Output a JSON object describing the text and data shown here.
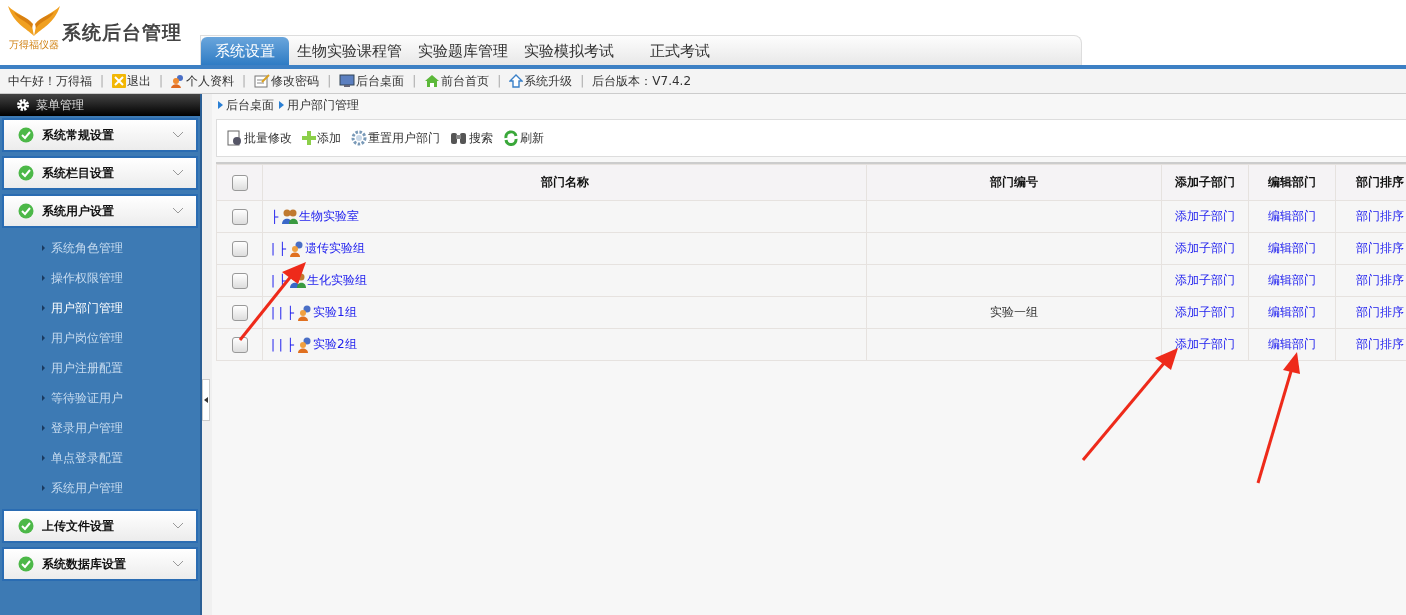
{
  "header": {
    "logo_text": "万得福仪器",
    "title": "系统后台管理"
  },
  "tabs": [
    {
      "label": "系统设置",
      "selected": true
    },
    {
      "label": "生物实验课程管",
      "selected": false
    },
    {
      "label": "实验题库管理",
      "selected": false
    },
    {
      "label": "实验模拟考试",
      "selected": false
    },
    {
      "label": "正式考试",
      "selected": false
    }
  ],
  "toolbar": {
    "items": [
      {
        "kind": "text",
        "label": "中午好！万得福"
      },
      {
        "kind": "separator",
        "label": "|"
      },
      {
        "kind": "logout",
        "label": "退出"
      },
      {
        "kind": "separator",
        "label": "|"
      },
      {
        "kind": "profile",
        "label": "个人资料"
      },
      {
        "kind": "separator",
        "label": "|"
      },
      {
        "kind": "password",
        "label": "修改密码"
      },
      {
        "kind": "separator",
        "label": "|"
      },
      {
        "kind": "desktop",
        "label": "后台桌面"
      },
      {
        "kind": "separator",
        "label": "|"
      },
      {
        "kind": "home",
        "label": "前台首页"
      },
      {
        "kind": "separator",
        "label": "|"
      },
      {
        "kind": "upgrade",
        "label": "系统升级"
      },
      {
        "kind": "separator",
        "label": "|"
      },
      {
        "kind": "text",
        "label": "后台版本：V7.4.2"
      }
    ]
  },
  "sidebar": {
    "title": "菜单管理",
    "groups": [
      {
        "label": "系统常规设置"
      },
      {
        "label": "系统栏目设置"
      },
      {
        "label": "系统用户设置",
        "items": [
          {
            "label": "系统角色管理",
            "selected": false
          },
          {
            "label": "操作权限管理",
            "selected": false
          },
          {
            "label": "用户部门管理",
            "selected": true
          },
          {
            "label": "用户岗位管理",
            "selected": false
          },
          {
            "label": "用户注册配置",
            "selected": false
          },
          {
            "label": "等待验证用户",
            "selected": false
          },
          {
            "label": "登录用户管理",
            "selected": false
          },
          {
            "label": "单点登录配置",
            "selected": false
          },
          {
            "label": "系统用户管理",
            "selected": false
          }
        ]
      },
      {
        "label": "上传文件设置"
      },
      {
        "label": "系统数据库设置"
      }
    ]
  },
  "breadcrumb": [
    "后台桌面",
    "用户部门管理"
  ],
  "actions": [
    {
      "kind": "batch",
      "label": "批量修改"
    },
    {
      "kind": "add",
      "label": "添加"
    },
    {
      "kind": "reset",
      "label": "重置用户部门"
    },
    {
      "kind": "search",
      "label": "搜索"
    },
    {
      "kind": "refresh",
      "label": "刷新"
    }
  ],
  "table": {
    "all_checked": false,
    "columns": [
      "部门名称",
      "部门编号",
      "添加子部门",
      "编辑部门",
      "部门排序"
    ],
    "rows": [
      {
        "prefix": "├",
        "name": "生物实验室",
        "kind": "group",
        "checked": false,
        "links": [
          "添加子部门",
          "编辑部门",
          "部门排序"
        ],
        "children": [
          {
            "prefix": "| ├",
            "name": "遗传实验组",
            "kind": "person",
            "checked": false,
            "links": [
              "添加子部门",
              "编辑部门",
              "部门排序"
            ]
          },
          {
            "prefix": "| ├",
            "name": "生化实验组",
            "kind": "group",
            "checked": false,
            "links": [
              "添加子部门",
              "编辑部门",
              "部门排序"
            ],
            "children": [
              {
                "prefix": "| | ├",
                "name": "实验1组",
                "kind": "person",
                "code": "实验一组",
                "checked": false,
                "links": [
                  "添加子部门",
                  "编辑部门",
                  "部门排序"
                ]
              },
              {
                "prefix": "| | ├",
                "name": "实验2组",
                "kind": "person",
                "checked": false,
                "links": [
                  "添加子部门",
                  "编辑部门",
                  "部门排序"
                ]
              }
            ]
          }
        ]
      }
    ]
  }
}
